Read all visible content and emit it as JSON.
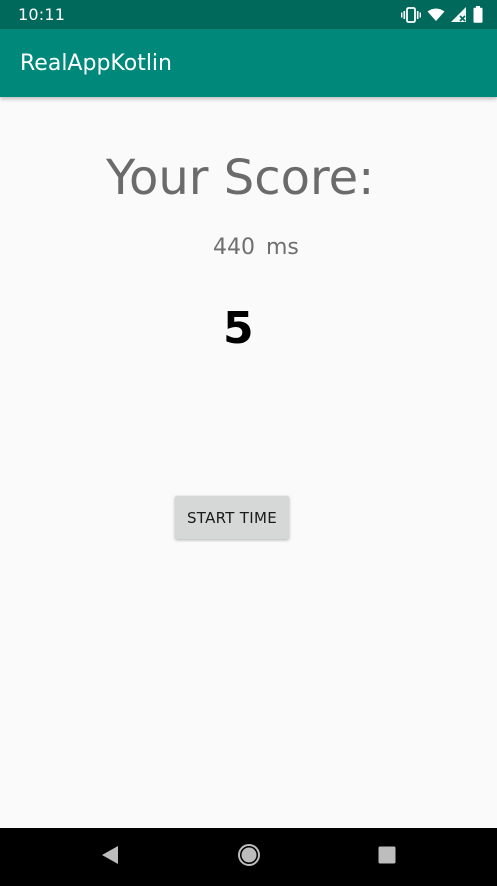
{
  "status_bar": {
    "time": "10:11",
    "icons": [
      "vibrate-icon",
      "wifi-icon",
      "signal-icon",
      "battery-icon"
    ]
  },
  "app_bar": {
    "title": "RealAppKotlin",
    "color": "#00897b",
    "status_color": "#00695c"
  },
  "main": {
    "score_label": "Your Score:",
    "time_value": "440",
    "time_unit": "ms",
    "count_value": "5",
    "start_button_label": "START TIME"
  },
  "nav_bar": {
    "buttons": [
      "back-icon",
      "home-icon",
      "recents-icon"
    ]
  }
}
